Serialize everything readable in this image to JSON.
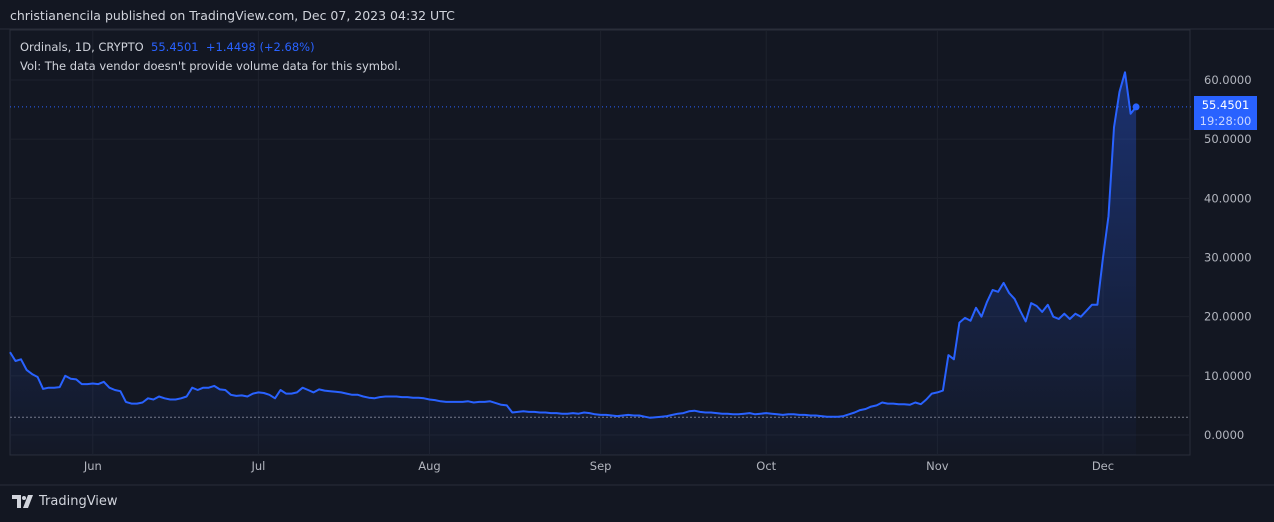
{
  "header": {
    "published": "christianencila published on TradingView.com, Dec 07, 2023 04:32 UTC"
  },
  "legend": {
    "symbol": "Ordinals, 1D, CRYPTO",
    "price": "55.4501",
    "change": "+1.4498",
    "change_pct": "(+2.68%)",
    "vol": "Vol: The data vendor doesn't provide volume data for this symbol."
  },
  "price_label": {
    "price": "55.4501",
    "countdown": "19:28:00"
  },
  "footer": {
    "brand": "TradingView",
    "logo_icon": "tradingview-logo-icon"
  },
  "colors": {
    "line": "#2962ff",
    "bg": "#131722",
    "grid": "#1e222d"
  },
  "chart_data": {
    "type": "line",
    "title": "Ordinals, 1D, CRYPTO",
    "start_date": "2023-05-17",
    "interval": "1D",
    "y_ticks": [
      "0.0000",
      "10.0000",
      "20.0000",
      "30.0000",
      "40.0000",
      "50.0000",
      "60.0000"
    ],
    "y_tick_values": [
      0,
      10,
      20,
      30,
      40,
      50,
      60
    ],
    "x_ticks": [
      {
        "label": "Jun",
        "day": 15
      },
      {
        "label": "Jul",
        "day": 45
      },
      {
        "label": "Aug",
        "day": 76
      },
      {
        "label": "Sep",
        "day": 107
      },
      {
        "label": "Oct",
        "day": 137
      },
      {
        "label": "Nov",
        "day": 168
      },
      {
        "label": "Dec",
        "day": 198
      }
    ],
    "ylim": [
      -2.5,
      71
    ],
    "low_line": 3.0,
    "values": [
      14,
      12.5,
      12.8,
      11,
      10.3,
      9.8,
      7.8,
      8,
      8,
      8.1,
      10,
      9.5,
      9.4,
      8.6,
      8.6,
      8.7,
      8.6,
      9,
      8,
      7.6,
      7.4,
      5.6,
      5.3,
      5.3,
      5.5,
      6.2,
      6,
      6.5,
      6.2,
      6,
      6,
      6.2,
      6.5,
      8,
      7.6,
      8,
      8,
      8.3,
      7.7,
      7.6,
      6.8,
      6.6,
      6.7,
      6.5,
      7,
      7.2,
      7.1,
      6.8,
      6.2,
      7.6,
      7,
      7,
      7.2,
      8,
      7.6,
      7.2,
      7.7,
      7.5,
      7.4,
      7.3,
      7.2,
      7,
      6.8,
      6.8,
      6.5,
      6.3,
      6.2,
      6.4,
      6.5,
      6.5,
      6.5,
      6.4,
      6.4,
      6.3,
      6.3,
      6.2,
      6,
      5.9,
      5.7,
      5.6,
      5.6,
      5.6,
      5.6,
      5.7,
      5.5,
      5.6,
      5.6,
      5.7,
      5.4,
      5.1,
      5,
      3.8,
      3.9,
      4,
      3.9,
      3.9,
      3.8,
      3.8,
      3.7,
      3.7,
      3.6,
      3.6,
      3.7,
      3.6,
      3.8,
      3.7,
      3.5,
      3.4,
      3.4,
      3.3,
      3.2,
      3.3,
      3.4,
      3.3,
      3.3,
      3.1,
      2.9,
      3,
      3.1,
      3.2,
      3.4,
      3.6,
      3.7,
      4,
      4.1,
      3.9,
      3.8,
      3.8,
      3.7,
      3.6,
      3.6,
      3.5,
      3.5,
      3.6,
      3.7,
      3.5,
      3.6,
      3.7,
      3.6,
      3.5,
      3.4,
      3.5,
      3.5,
      3.4,
      3.4,
      3.3,
      3.3,
      3.2,
      3.1,
      3.1,
      3.1,
      3.2,
      3.5,
      3.8,
      4.2,
      4.4,
      4.8,
      5,
      5.5,
      5.3,
      5.3,
      5.2,
      5.2,
      5.1,
      5.5,
      5.2,
      6,
      7,
      7.2,
      7.5,
      13.5,
      12.8,
      19,
      19.8,
      19.3,
      21.5,
      20,
      22.5,
      24.5,
      24.2,
      25.7,
      24,
      23,
      21,
      19.2,
      22.3,
      21.8,
      20.8,
      22,
      20,
      19.6,
      20.5,
      19.6,
      20.5,
      20,
      21,
      22,
      22,
      30,
      37,
      52,
      58,
      61.3,
      54.3,
      55.45
    ]
  }
}
